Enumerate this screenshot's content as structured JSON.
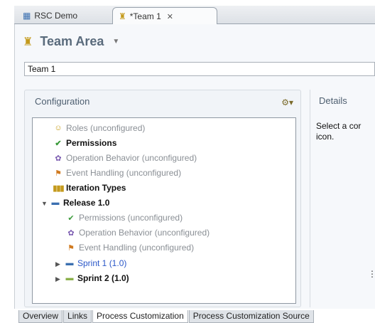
{
  "editor_tabs": [
    {
      "label": "RSC Demo",
      "icon": "repository-icon"
    },
    {
      "label": "*Team 1",
      "icon": "team-area-icon",
      "close": "✕"
    }
  ],
  "header": {
    "title": "Team Area",
    "icon": "team-area-icon"
  },
  "name_field": {
    "value": "Team 1"
  },
  "configuration": {
    "title": "Configuration",
    "menu_icon": "configuration-menu-icon",
    "tree": [
      {
        "label": "Roles (unconfigured)",
        "style": "gray",
        "icon": "roles-icon"
      },
      {
        "label": "Permissions",
        "style": "bold",
        "icon": "permissions-icon"
      },
      {
        "label": "Operation Behavior (unconfigured)",
        "style": "gray",
        "icon": "operation-behavior-icon"
      },
      {
        "label": "Event Handling (unconfigured)",
        "style": "gray",
        "icon": "event-handling-icon"
      },
      {
        "label": "Iteration Types",
        "style": "bold",
        "icon": "iteration-types-icon"
      },
      {
        "label": "Release 1.0",
        "style": "bold",
        "icon": "release-icon",
        "expanded": true
      },
      {
        "label": "Permissions (unconfigured)",
        "style": "gray",
        "icon": "permissions-icon"
      },
      {
        "label": "Operation Behavior (unconfigured)",
        "style": "gray",
        "icon": "operation-behavior-icon"
      },
      {
        "label": "Event Handling (unconfigured)",
        "style": "gray",
        "icon": "event-handling-icon"
      },
      {
        "label": "Sprint 1 (1.0)",
        "style": "blue",
        "icon": "sprint-icon",
        "expanded": false
      },
      {
        "label": "Sprint 2 (1.0)",
        "style": "bold",
        "icon": "sprint-icon",
        "expanded": false
      }
    ]
  },
  "details": {
    "title": "Details",
    "text": "Select a cor icon."
  },
  "page_tabs": [
    {
      "label": "Overview",
      "active": false
    },
    {
      "label": "Links",
      "active": false
    },
    {
      "label": "Process Customization",
      "active": true
    },
    {
      "label": "Process Customization Source",
      "active": false
    }
  ],
  "colors": {
    "link_blue": "#2a57c8",
    "section_heading": "#4e5f70",
    "unconfigured_gray": "#8a8f95"
  }
}
